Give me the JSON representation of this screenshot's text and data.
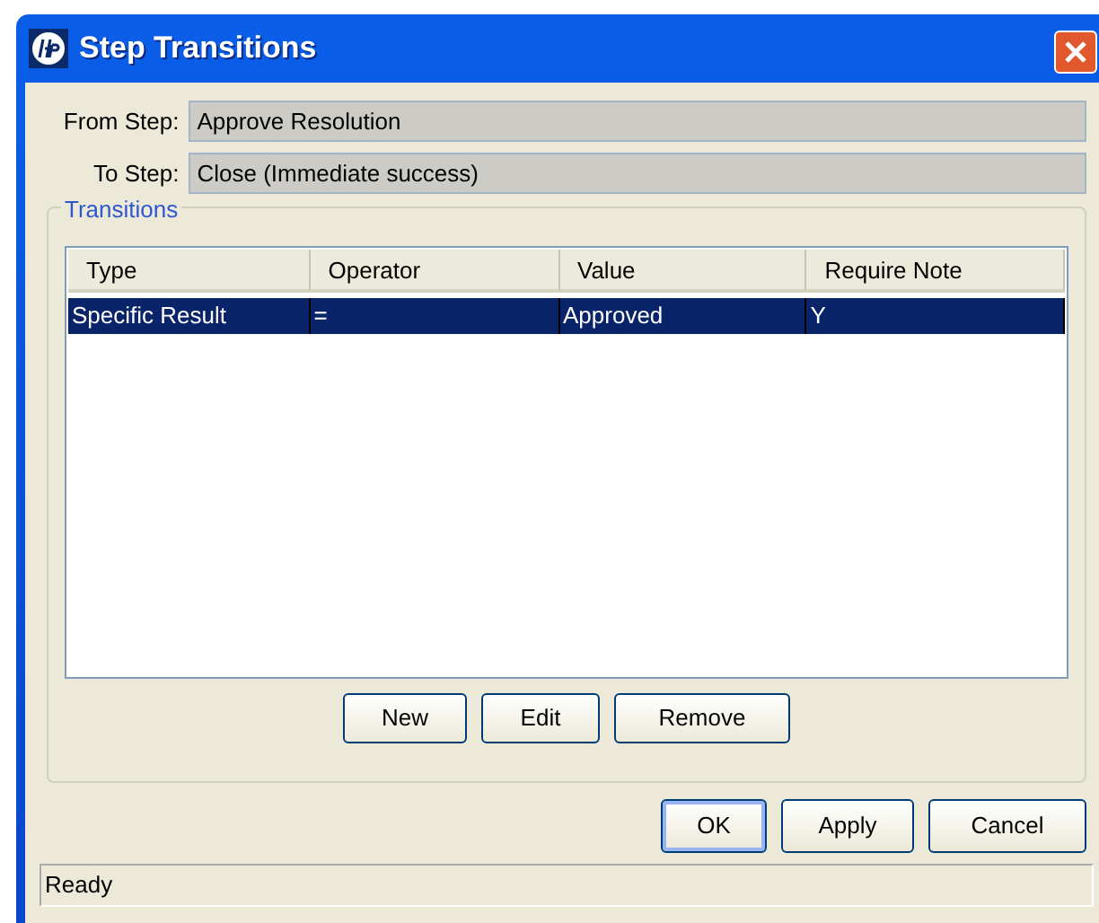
{
  "window": {
    "title": "Step Transitions"
  },
  "fields": [
    {
      "label": "From Step:",
      "value": "Approve Resolution"
    },
    {
      "label": "To Step:",
      "value": "Close (Immediate success)"
    }
  ],
  "group": {
    "title": "Transitions"
  },
  "table": {
    "columns": [
      "Type",
      "Operator",
      "Value",
      "Require Note"
    ],
    "rows": [
      {
        "cells": [
          "Specific Result",
          "=",
          "Approved",
          "Y"
        ],
        "selected": true
      }
    ]
  },
  "group_buttons": [
    "New",
    "Edit",
    "Remove"
  ],
  "buttons": [
    {
      "label": "OK",
      "default": true
    },
    {
      "label": "Apply",
      "default": false
    },
    {
      "label": "Cancel",
      "default": false
    }
  ],
  "status_bar": "Ready"
}
